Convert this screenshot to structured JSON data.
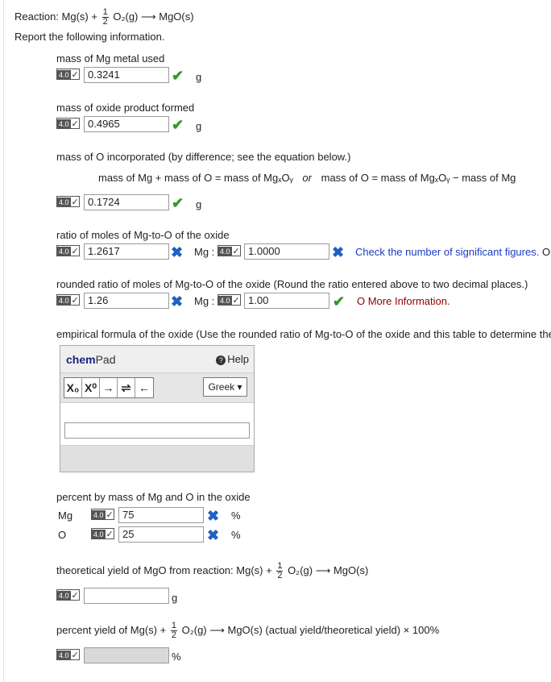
{
  "header": {
    "reaction_prefix": "Reaction: Mg(s) +",
    "frac_num": "1",
    "frac_den": "2",
    "reaction_suffix": "O₂(g) ⟶ MgO(s)",
    "instruction": "Report the following information."
  },
  "badge": {
    "points": "4.0",
    "check": "✓"
  },
  "q1": {
    "label": "mass of Mg metal used",
    "value": "0.3241",
    "unit": "g",
    "status": "correct"
  },
  "q2": {
    "label": "mass of oxide product formed",
    "value": "0.4965",
    "unit": "g",
    "status": "correct"
  },
  "q3": {
    "label": "mass of O incorporated (by difference; see the equation below.)",
    "equation_left": "mass of Mg + mass of O = mass of MgₓOᵧ",
    "equation_or": "or",
    "equation_right": "mass of O = mass of MgₓOᵧ − mass of Mg",
    "value": "0.1724",
    "unit": "g",
    "status": "correct"
  },
  "q4": {
    "label": "ratio of moles of Mg-to-O of the oxide",
    "value_mg": "1.2617",
    "mg_label": "Mg :",
    "value_o": "1.0000",
    "feedback": "Check the number of significant figures.",
    "feedback_cont": "O"
  },
  "q5": {
    "label": "rounded ratio of moles of Mg-to-O of the oxide (Round the ratio entered above to two decimal places.)",
    "value_mg": "1.26",
    "mg_label": "Mg :",
    "value_o": "1.00",
    "more_info": "O More Information."
  },
  "q6": {
    "label": "empirical formula of the oxide (Use the rounded ratio of Mg-to-O of the oxide and this table to determine the"
  },
  "chempad": {
    "title_bold": "chem",
    "title_rest": "Pad",
    "help_icon": "?",
    "help": "Help",
    "buttons": [
      "X₀",
      "X⁰",
      "→",
      "⇌",
      "←"
    ],
    "greek": "Greek ▾"
  },
  "q7": {
    "label": "percent by mass of Mg and O in the oxide",
    "rows": [
      {
        "element": "Mg",
        "value": "75",
        "unit": "%"
      },
      {
        "element": "O",
        "value": "25",
        "unit": "%"
      }
    ]
  },
  "q8": {
    "label_prefix": "theoretical yield of MgO from reaction: Mg(s) +",
    "label_suffix": "O₂(g) ⟶ MgO(s)",
    "value": "",
    "unit": "g"
  },
  "q9": {
    "label_prefix": "percent yield of Mg(s) +",
    "label_suffix": "O₂(g) ⟶ MgO(s)    (actual yield/theoretical yield) × 100%",
    "value": "",
    "unit": "%"
  },
  "icons": {
    "correct": "✔",
    "incorrect": "✖"
  }
}
